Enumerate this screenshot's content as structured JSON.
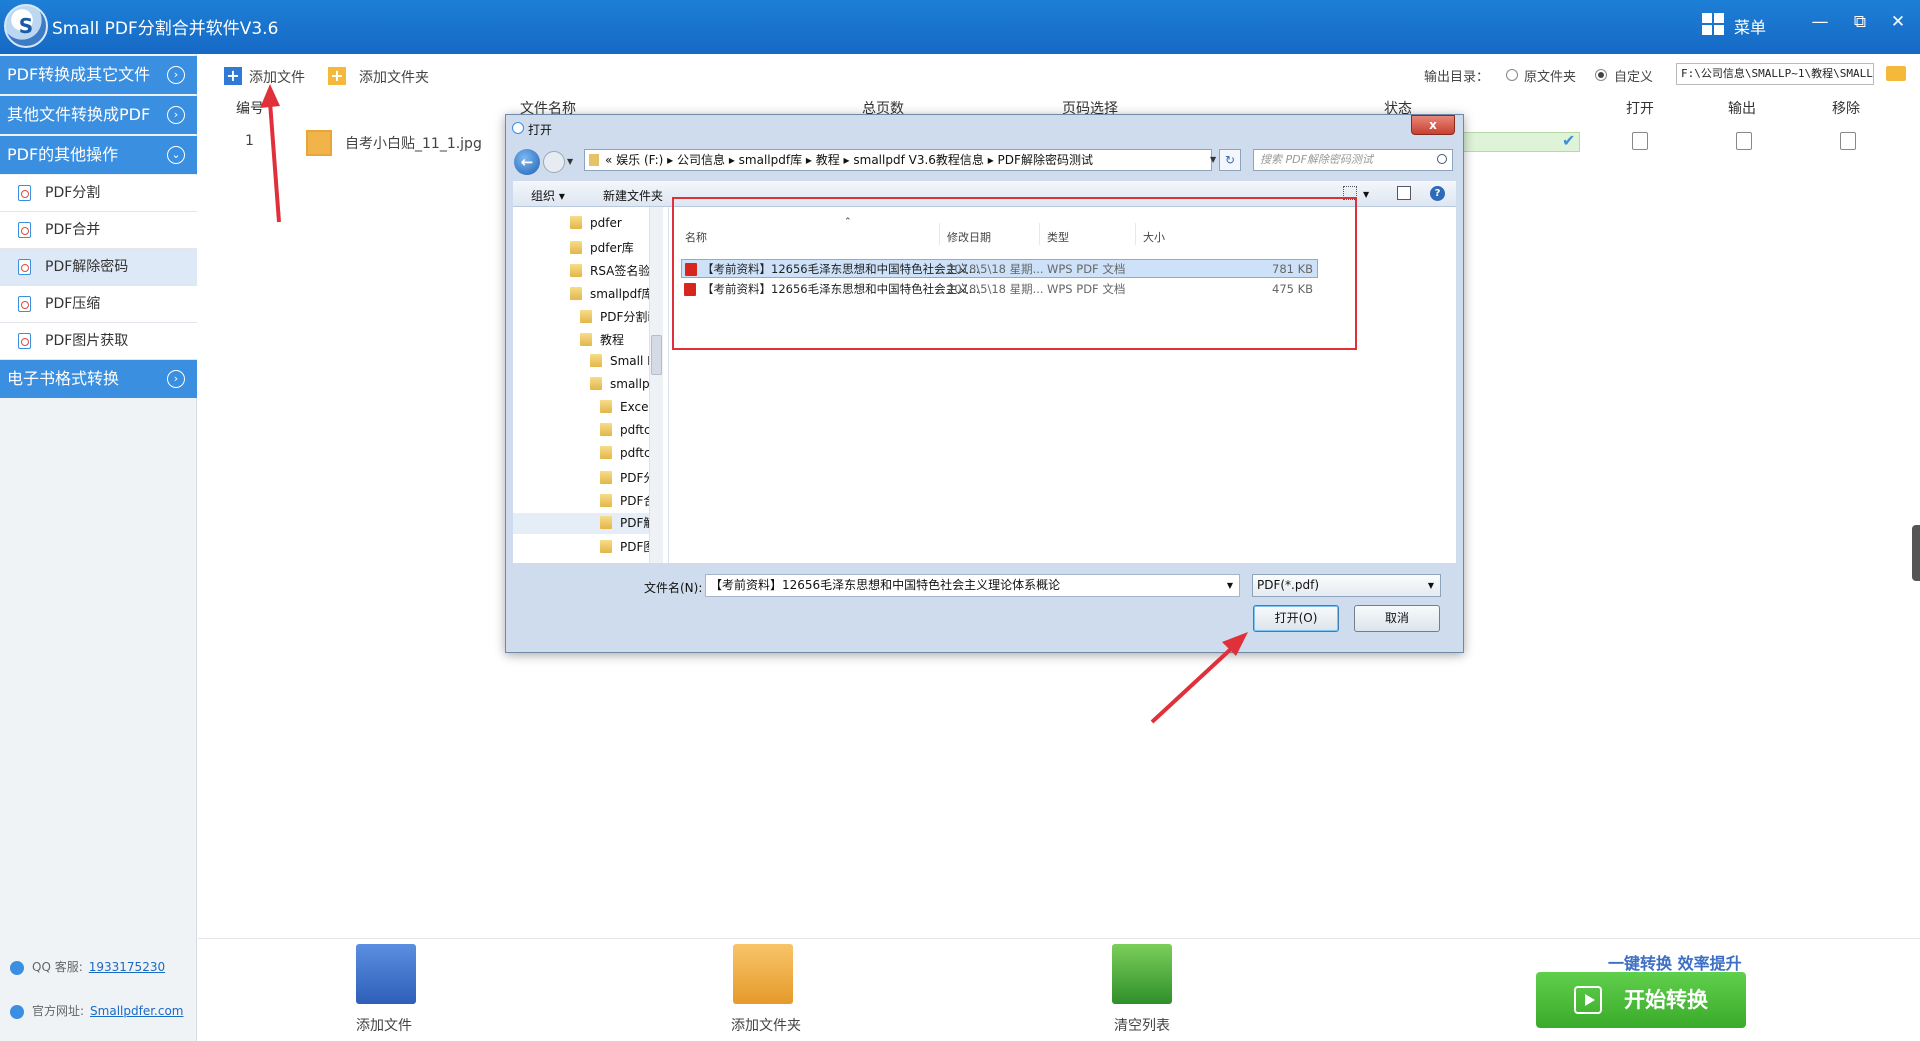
{
  "app": {
    "title": "Small PDF分割合并软件V3.6",
    "logo_letter": "S",
    "menu_label": "菜单",
    "minimize_glyph": "—",
    "restore_glyph": "⧉",
    "close_glyph": "✕"
  },
  "sidebar": {
    "sections": [
      {
        "label": "PDF转换成其它文件",
        "chevron": "›"
      },
      {
        "label": "其他文件转换成PDF",
        "chevron": "›"
      },
      {
        "label": "PDF的其他操作",
        "chevron": "⌄"
      },
      {
        "label": "电子书格式转换",
        "chevron": "›"
      }
    ],
    "items": [
      {
        "label": "PDF分割"
      },
      {
        "label": "PDF合并"
      },
      {
        "label": "PDF解除密码"
      },
      {
        "label": "PDF压缩"
      },
      {
        "label": "PDF图片获取"
      }
    ],
    "active_item": "PDF解除密码",
    "qq_label": "QQ 客服:",
    "qq_value": "1933175230",
    "site_label": "官方网址:",
    "site_value": "Smallpdfer.com"
  },
  "toolbar": {
    "add_file": "添加文件",
    "add_folder": "添加文件夹",
    "output_dir_label": "输出目录：",
    "option_original": "原文件夹",
    "option_custom": "自定义",
    "selected_option": "自定义",
    "output_path": "F:\\公司信息\\SMALLP~1\\教程\\SMALLP"
  },
  "table": {
    "headers": [
      "编号",
      "文件名称",
      "总页数",
      "页码选择",
      "状态",
      "打开",
      "输出",
      "移除"
    ],
    "rows": [
      {
        "index": "1",
        "filename": "自考小白贴_11_1.jpg"
      }
    ]
  },
  "bottom": {
    "add_file": "添加文件",
    "add_folder": "添加文件夹",
    "clear_list": "清空列表",
    "slogan": "一键转换  效率提升",
    "start": "开始转换"
  },
  "dialog": {
    "title": "打开",
    "close_glyph": "x",
    "back_glyph": "←",
    "address": "«  娱乐 (F:)  ▸  公司信息  ▸  smallpdf库  ▸  教程  ▸  smallpdf V3.6教程信息  ▸  PDF解除密码测试",
    "refresh_glyph": "↻",
    "search_placeholder": "搜索 PDF解除密码测试",
    "organize": "组织 ▾",
    "new_folder": "新建文件夹",
    "help_glyph": "?",
    "tree": [
      {
        "label": "pdfer"
      },
      {
        "label": "pdfer库"
      },
      {
        "label": "RSA签名验"
      },
      {
        "label": "smallpdf库"
      },
      {
        "label": "PDF分割i"
      },
      {
        "label": "教程"
      },
      {
        "label": "Small F"
      },
      {
        "label": "smallp"
      },
      {
        "label": "Excel"
      },
      {
        "label": "pdftc"
      },
      {
        "label": "pdftc"
      },
      {
        "label": "PDF分"
      },
      {
        "label": "PDF合"
      },
      {
        "label": "PDF解"
      },
      {
        "label": "PDF图"
      }
    ],
    "selected_tree_item": "PDF解",
    "columns": {
      "name": "名称",
      "modified": "修改日期",
      "type": "类型",
      "size": "大小"
    },
    "files": [
      {
        "name": "【考前资料】12656毛泽东思想和中国特色社会主义...",
        "modified": "2018\\5\\18 星期...",
        "type": "WPS PDF 文档",
        "size": "781 KB"
      },
      {
        "name": "【考前资料】12656毛泽东思想和中国特色社会主义...",
        "modified": "2018\\5\\18 星期...",
        "type": "WPS PDF 文档",
        "size": "475 KB"
      }
    ],
    "selected_file_index": 0,
    "filename_label": "文件名(N):",
    "filename_value": "【考前资料】12656毛泽东思想和中国特色社会主义理论体系概论",
    "filetype_value": "PDF(*.pdf)",
    "open_button": "打开(O)",
    "cancel_button": "取消"
  },
  "colors": {
    "titlebar": "#1669c4",
    "sidebar_section": "#3a8fe0",
    "start_button": "#3aaa2a",
    "annotation_red": "#e0303a"
  }
}
